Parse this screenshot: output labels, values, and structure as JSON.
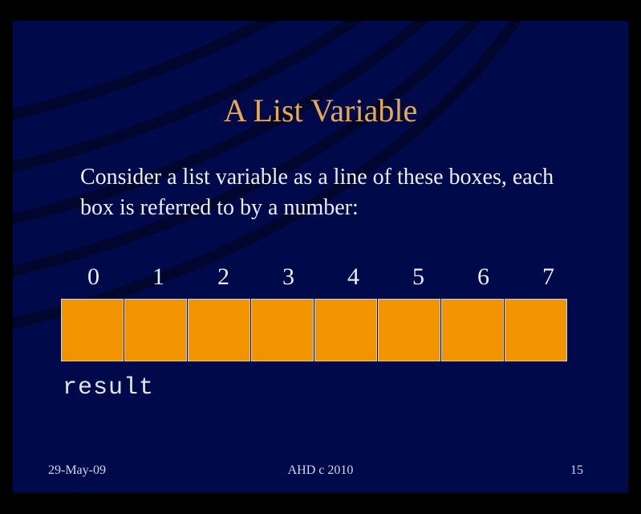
{
  "title": "A List Variable",
  "body": "Consider a list variable as a line of these boxes, each box is referred to by a number:",
  "indices": [
    "0",
    "1",
    "2",
    "3",
    "4",
    "5",
    "6",
    "7"
  ],
  "var_name": "result",
  "colors": {
    "box": "#f29400",
    "slide_bg": "#000a4a",
    "title": "#e8a94e"
  },
  "footer": {
    "left": "29-May-09",
    "center": "AHD  c  2010",
    "right": "15"
  }
}
